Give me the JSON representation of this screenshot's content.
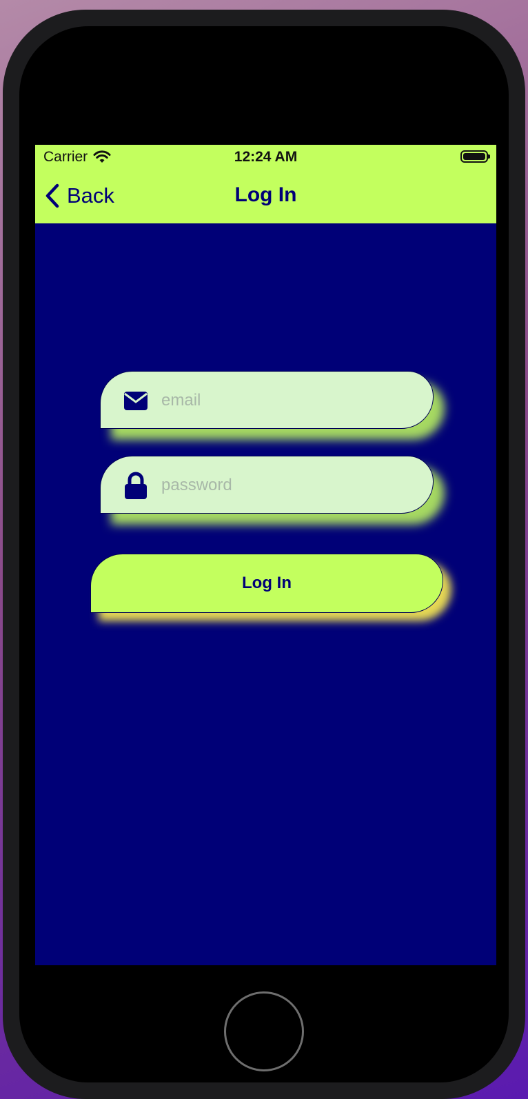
{
  "status_bar": {
    "carrier": "Carrier",
    "time": "12:24 AM"
  },
  "nav": {
    "back_label": "Back",
    "title": "Log In"
  },
  "form": {
    "email_placeholder": "email",
    "password_placeholder": "password",
    "login_label": "Log In"
  },
  "icons": {
    "email": "envelope-icon",
    "password": "lock-icon",
    "back": "chevron-left-icon",
    "wifi": "wifi-icon",
    "battery": "battery-icon"
  },
  "colors": {
    "accent": "#c3ff5e",
    "background": "#000077",
    "field": "#d8f5cc",
    "button_glow": "#fff050"
  }
}
